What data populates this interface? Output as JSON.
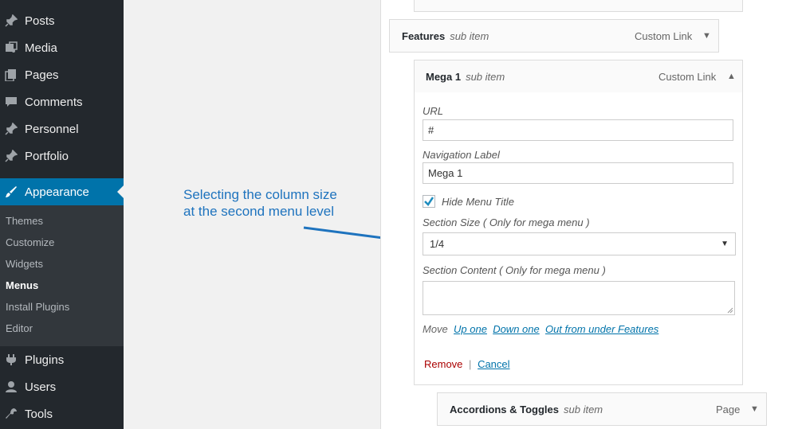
{
  "sidebar": {
    "items_top": [
      {
        "label": "Posts",
        "icon": "pin-icon"
      },
      {
        "label": "Media",
        "icon": "media-icon"
      },
      {
        "label": "Pages",
        "icon": "pages-icon"
      },
      {
        "label": "Comments",
        "icon": "comment-icon"
      },
      {
        "label": "Personnel",
        "icon": "pin-icon"
      },
      {
        "label": "Portfolio",
        "icon": "pin-icon"
      }
    ],
    "active": {
      "label": "Appearance",
      "icon": "brush-icon"
    },
    "submenu": [
      "Themes",
      "Customize",
      "Widgets",
      "Menus",
      "Install Plugins",
      "Editor"
    ],
    "submenu_current": "Menus",
    "items_bottom": [
      {
        "label": "Plugins",
        "icon": "plugin-icon"
      },
      {
        "label": "Users",
        "icon": "user-icon"
      },
      {
        "label": "Tools",
        "icon": "wrench-icon"
      }
    ],
    "colors": {
      "bg": "#23282d",
      "active": "#0073aa",
      "submenu_bg": "#32373c"
    }
  },
  "annotation": {
    "line1": "Selecting the column size",
    "line2": "at the second menu level",
    "color": "#1e73be"
  },
  "menu": {
    "features": {
      "title": "Features",
      "sub": "sub item",
      "type": "Custom Link"
    },
    "mega1": {
      "title": "Mega 1",
      "sub": "sub item",
      "type": "Custom Link"
    },
    "accordions": {
      "title": "Accordions & Toggles",
      "sub": "sub item",
      "type": "Page"
    }
  },
  "settings": {
    "url_label": "URL",
    "url_value": "#",
    "nav_label": "Navigation Label",
    "nav_value": "Mega 1",
    "hide_title_label": "Hide Menu Title",
    "hide_title_checked": true,
    "section_size_label": "Section Size ( Only for mega menu )",
    "section_size_value": "1/4",
    "section_content_label": "Section Content ( Only for mega menu )",
    "move_label": "Move",
    "move_up": "Up one",
    "move_down": "Down one",
    "move_out": "Out from under Features",
    "remove": "Remove",
    "separator": "|",
    "cancel": "Cancel"
  }
}
